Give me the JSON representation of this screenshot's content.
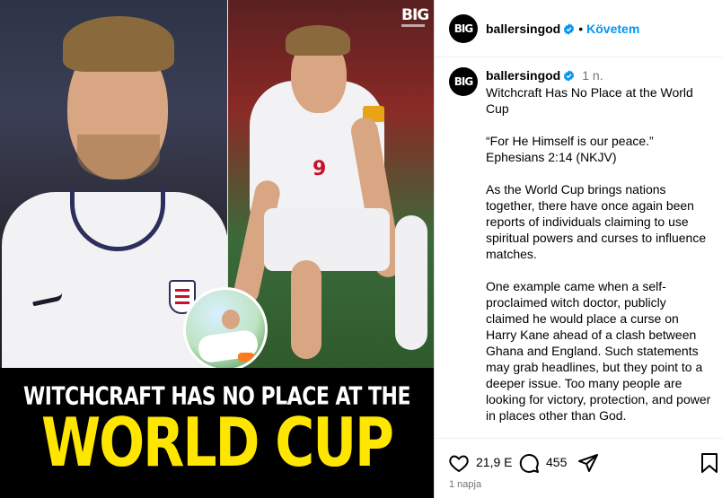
{
  "media": {
    "logo": "BIG",
    "headline_line1": "WITCHCRAFT HAS NO PLACE AT THE",
    "headline_line2": "WORLD CUP",
    "shirt_number": "9",
    "headline_color": "#ffe600"
  },
  "header": {
    "avatar_text": "BIG",
    "username": "ballersingod",
    "separator": "•",
    "follow_label": "Követem"
  },
  "caption": {
    "avatar_text": "BIG",
    "username": "ballersingod",
    "time": "1 n.",
    "paragraphs": [
      "Witchcraft Has No Place at the World Cup",
      "“For He Himself is our peace.” Ephesians 2:14 (NKJV)",
      "As the World Cup brings nations together, there have once again been reports of individuals claiming to use spiritual powers and curses to influence matches.",
      "One example came when a self-proclaimed witch doctor, publicly claimed he would place a curse on Harry Kane ahead of a clash between Ghana and England. Such statements may grab headlines, but they point to a deeper issue. Too many people are looking for victory, protection, and power in places other than God."
    ]
  },
  "actions": {
    "likes": "21,9 E",
    "comments": "455",
    "icons": [
      "heart-icon",
      "comment-icon",
      "share-icon",
      "bookmark-icon"
    ]
  },
  "footer": {
    "date": "1 napja"
  },
  "colors": {
    "verified": "#0095f6",
    "follow": "#0095f6",
    "muted": "#737373"
  }
}
